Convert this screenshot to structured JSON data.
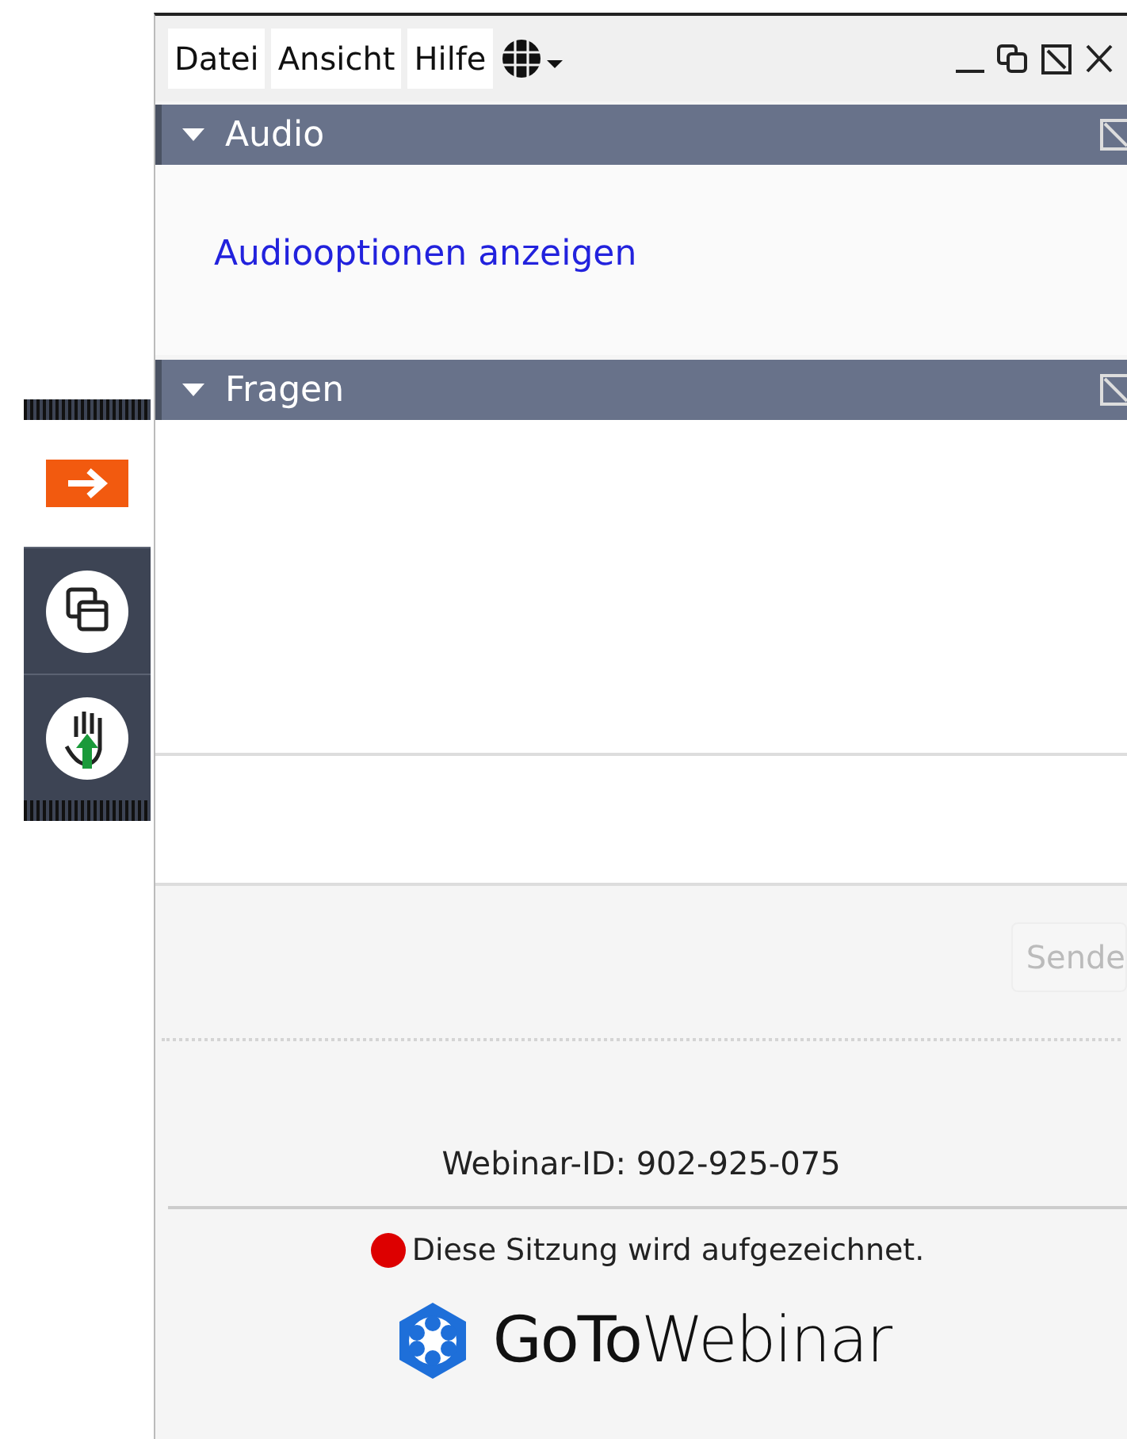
{
  "menu": [
    {
      "label": "Datei"
    },
    {
      "label": "Ansicht"
    },
    {
      "label": "Hilfe"
    }
  ],
  "panels": [
    {
      "title": "Audio",
      "expanded": true,
      "link": "Audiooptionen anzeigen"
    },
    {
      "title": "Fragen",
      "expanded": true
    }
  ],
  "send_button": {
    "label": "Sende",
    "disabled": true
  },
  "side_toolbar": [
    {
      "kind": "arrow",
      "selected": true
    },
    {
      "kind": "windows",
      "selected": false
    },
    {
      "kind": "hand",
      "selected": false
    }
  ],
  "webinar_id": "Webinar-ID: 902-925-075",
  "recording": {
    "text": "Diese Sitzung wird aufgezeichnet.",
    "color": "#dd0000"
  },
  "logo": "**GoTo**Webinar"
}
